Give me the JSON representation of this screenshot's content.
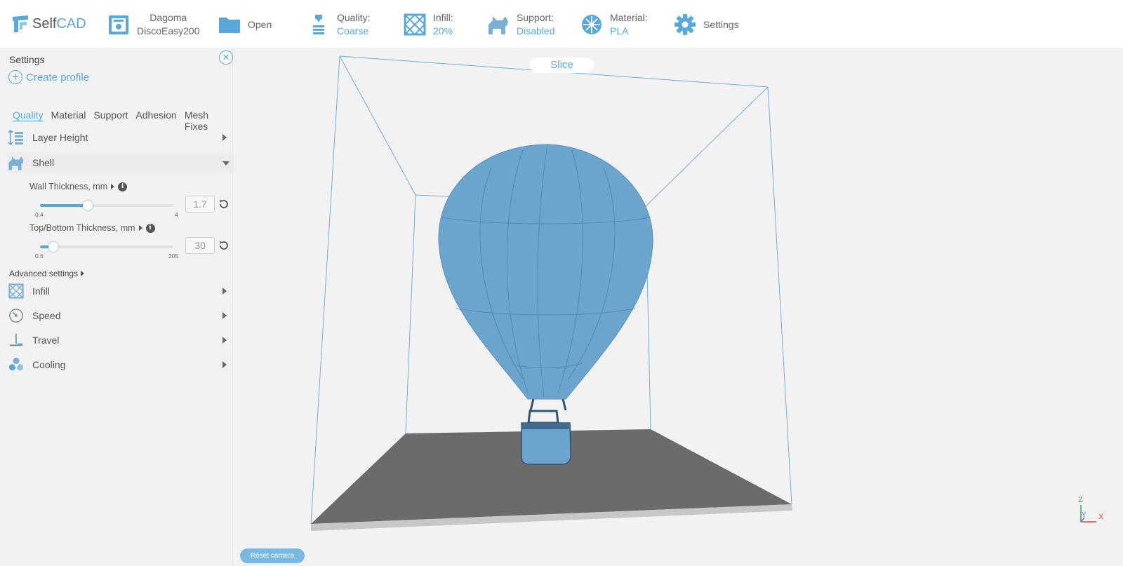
{
  "topbar": {
    "logo": {
      "self": "Self",
      "cad": "CAD"
    },
    "printer": {
      "line1": "Dagoma",
      "line2": "DiscoEasy200"
    },
    "open": {
      "label": "Open"
    },
    "quality": {
      "label": "Quality:",
      "value": "Coarse"
    },
    "infill": {
      "label": "Infill:",
      "value": "20%"
    },
    "support": {
      "label": "Support:",
      "value": "Disabled"
    },
    "material": {
      "label": "Material:",
      "value": "PLA"
    },
    "settings": {
      "label": "Settings"
    }
  },
  "sidebar": {
    "title": "Settings",
    "close_glyph": "✕",
    "create_profile": "Create profile",
    "tabs": [
      "Quality",
      "Material",
      "Support",
      "Adhesion",
      "Mesh Fixes"
    ],
    "active_tab": "Quality",
    "sections": {
      "layer_height": "Layer Height",
      "shell": "Shell",
      "infill": "Infill",
      "speed": "Speed",
      "travel": "Travel",
      "cooling": "Cooling"
    },
    "wall_thickness": {
      "label": "Wall Thickness, mm",
      "min": "0.4",
      "max": "4",
      "value": "1.7",
      "level": 0.36
    },
    "top_bottom_thickness": {
      "label": "Top/Bottom Thickness, mm",
      "min": "0.6",
      "max": "205",
      "value": "30",
      "level": 0.1
    },
    "advanced_settings": "Advanced settings"
  },
  "viewport": {
    "slice_label": "Slice",
    "reset_camera_label": "Reset camera",
    "axes": {
      "z": "Z",
      "y": "Y",
      "x": "X"
    }
  },
  "colors": {
    "accent": "#5aa8db",
    "model": "#6ba4cc",
    "bed": "#6b6b6b"
  }
}
